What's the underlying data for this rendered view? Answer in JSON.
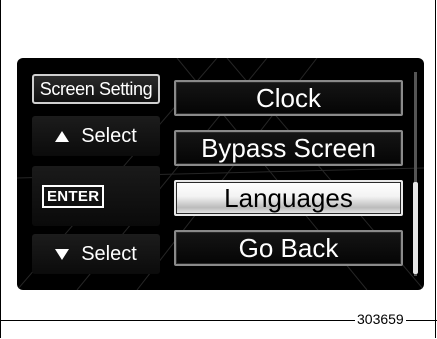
{
  "sidebar": {
    "title": "Screen Setting",
    "select_up_label": "Select",
    "enter_label": "ENTER",
    "select_down_label": "Select"
  },
  "menu": {
    "items": [
      {
        "label": "Clock",
        "selected": false
      },
      {
        "label": "Bypass Screen",
        "selected": false
      },
      {
        "label": "Languages",
        "selected": true
      },
      {
        "label": "Go Back",
        "selected": false
      }
    ]
  },
  "icons": {
    "up": "triangle-up-icon",
    "down": "triangle-down-icon"
  },
  "colors": {
    "screen_background": "#000000",
    "text": "#ffffff",
    "selected_background": "#ffffff",
    "selected_text": "#000000"
  },
  "figure_number": "303659"
}
